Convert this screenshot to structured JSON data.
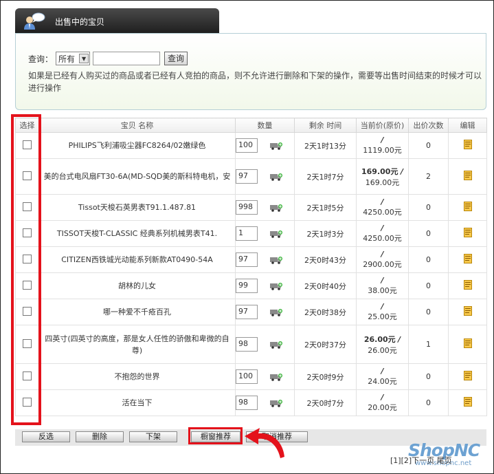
{
  "tab": {
    "title": "出售中的宝贝",
    "icon": "user-speech-icon"
  },
  "search": {
    "label": "查询：",
    "select_value": "所有",
    "input_value": "",
    "button_label": "查询"
  },
  "notice": "如果是已经有人购买过的商品或者已经有人竞拍的商品，则不允许进行删除和下架的操作，需要等出售时间结束的时候才可以进行操作",
  "table": {
    "headers": [
      "选择",
      "宝贝 名称",
      "数量",
      "剩余 时间",
      "当前价(原价)",
      "出价次数",
      "编辑"
    ],
    "rows": [
      {
        "name": "PHILIPS飞利浦吸尘器FC8264/02嫩绿色",
        "qty": "100",
        "remaining": "2天1时13分",
        "current": "",
        "original": "1119.00元",
        "bids": "0"
      },
      {
        "name": "美的台式电风扇FT30-6A(MD-SQD美的斯科特电机，安",
        "qty": "97",
        "remaining": "2天1时7分",
        "current": "169.00元",
        "original": "169.00元",
        "bids": "2"
      },
      {
        "name": "Tissot天梭石英男表T91.1.487.81",
        "qty": "998",
        "remaining": "2天1时5分",
        "current": "",
        "original": "4250.00元",
        "bids": "0"
      },
      {
        "name": "TISSOT天梭T-CLASSIC 经典系列机械男表T41.",
        "qty": "1",
        "remaining": "2天1时3分",
        "current": "",
        "original": "4250.00元",
        "bids": "0"
      },
      {
        "name": "CITIZEN西铁城光动能系列新款AT0490-54A",
        "qty": "97",
        "remaining": "2天0时43分",
        "current": "",
        "original": "2900.00元",
        "bids": "0"
      },
      {
        "name": "胡林的儿女",
        "qty": "99",
        "remaining": "2天0时40分",
        "current": "",
        "original": "38.00元",
        "bids": "0"
      },
      {
        "name": "哪一种爱不千疮百孔",
        "qty": "97",
        "remaining": "2天0时38分",
        "current": "",
        "original": "25.00元",
        "bids": "0"
      },
      {
        "name": "四英寸(四英寸的高度，那是女人任性的骄傲和卑微的自尊)",
        "qty": "98",
        "remaining": "2天0时37分",
        "current": "26.00元",
        "original": "26.00元",
        "bids": "1"
      },
      {
        "name": "不抱怨的世界",
        "qty": "100",
        "remaining": "2天0时9分",
        "current": "",
        "original": "24.00元",
        "bids": "0"
      },
      {
        "name": "活在当下",
        "qty": "98",
        "remaining": "2天0时7分",
        "current": "",
        "original": "20.00元",
        "bids": "0"
      }
    ]
  },
  "footer": {
    "buttons": [
      "反选",
      "删除",
      "下架",
      "橱窗推荐",
      "取消推荐"
    ],
    "pager": "[1][2]下一页 尾页"
  },
  "logo": {
    "brand": "ShopNC",
    "url": "www.shopnc.net"
  },
  "colors": {
    "highlight": "#e4121b",
    "tab_bg": "#2e2e2e",
    "panel_border": "#b5cfd6"
  }
}
